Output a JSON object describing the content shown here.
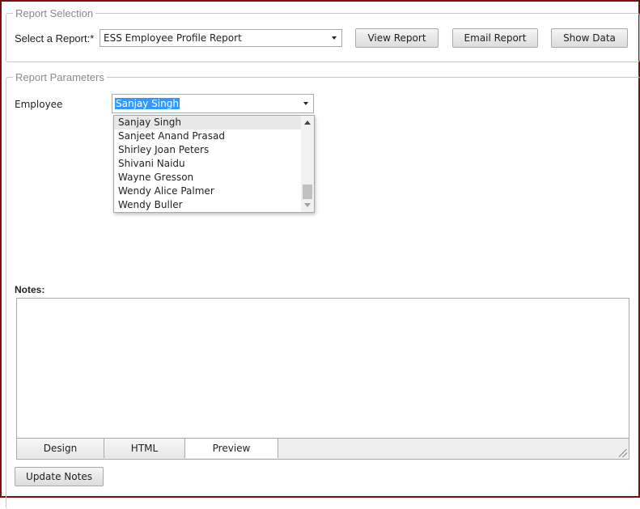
{
  "report_selection": {
    "legend": "Report Selection",
    "select_label": "Select a Report:",
    "required_mark": "*",
    "selected_report": "ESS Employee Profile Report",
    "buttons": {
      "view": "View Report",
      "email": "Email Report",
      "show": "Show Data"
    }
  },
  "report_parameters": {
    "legend": "Report Parameters",
    "employee_label": "Employee",
    "employee_selected": "Sanjay Singh",
    "employee_options": [
      "Sanjay Singh",
      "Sanjeet Anand Prasad",
      "Shirley Joan Peters",
      "Shivani Naidu",
      "Wayne Gresson",
      "Wendy Alice Palmer",
      "Wendy Buller"
    ],
    "list_scroll_position": 0.88
  },
  "notes": {
    "label": "Notes:",
    "content": "",
    "tabs": [
      "Design",
      "HTML",
      "Preview"
    ],
    "active_tab": "Preview",
    "update_button": "Update Notes"
  },
  "colors": {
    "frame_border": "#7a1010",
    "selection_highlight": "#3399ff",
    "legend_text": "#8a8a8a"
  }
}
